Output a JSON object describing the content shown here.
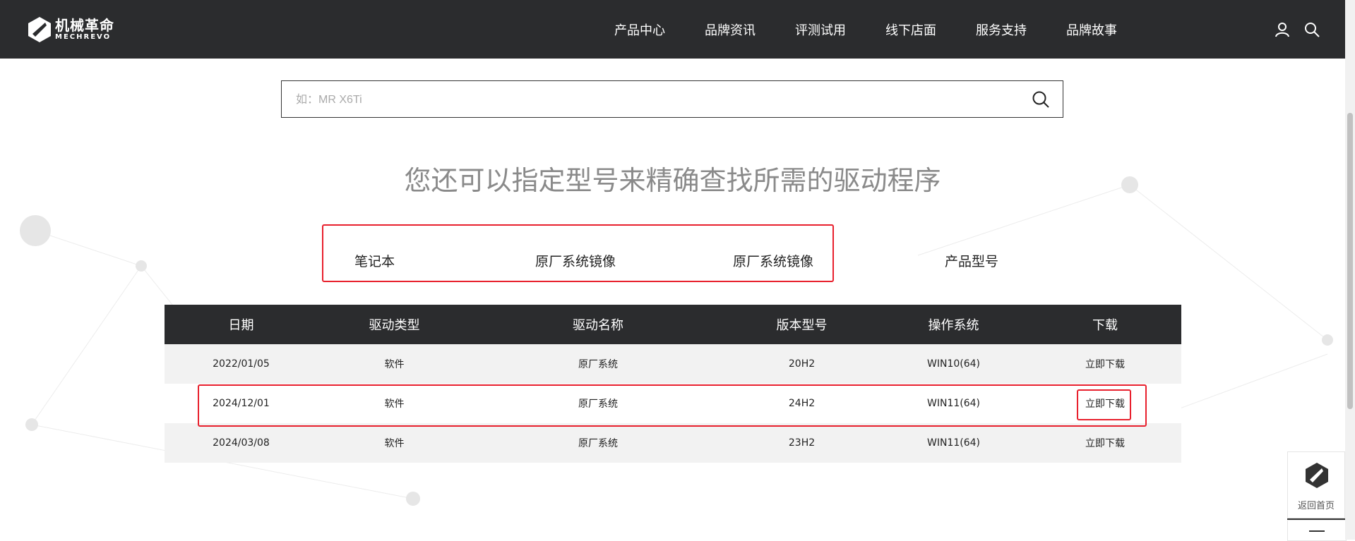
{
  "header": {
    "logo_cn": "机械革命",
    "logo_en": "MECHREVO",
    "nav": [
      "产品中心",
      "品牌资讯",
      "评测试用",
      "线下店面",
      "服务支持",
      "品牌故事"
    ],
    "icons": [
      "user-icon",
      "search-icon"
    ]
  },
  "search": {
    "placeholder": "如：MR X6Ti",
    "value": ""
  },
  "headline": "您还可以指定型号来精确查找所需的驱动程序",
  "filters": [
    "笔记本",
    "原厂系统镜像",
    "原厂系统镜像",
    "产品型号"
  ],
  "table": {
    "columns": [
      "日期",
      "驱动类型",
      "驱动名称",
      "版本型号",
      "操作系统",
      "下载"
    ],
    "rows": [
      [
        "2022/01/05",
        "软件",
        "原厂系统",
        "20H2",
        "WIN10(64)",
        "立即下载"
      ],
      [
        "2024/12/01",
        "软件",
        "原厂系统",
        "24H2",
        "WIN11(64)",
        "立即下载"
      ],
      [
        "2024/03/08",
        "软件",
        "原厂系统",
        "23H2",
        "WIN11(64)",
        "立即下载"
      ]
    ]
  },
  "float_widget": {
    "label": "返回首页"
  },
  "colors": {
    "header_bg": "#2b2c2e",
    "highlight": "#e8202d",
    "headline": "#8a8a8a"
  }
}
